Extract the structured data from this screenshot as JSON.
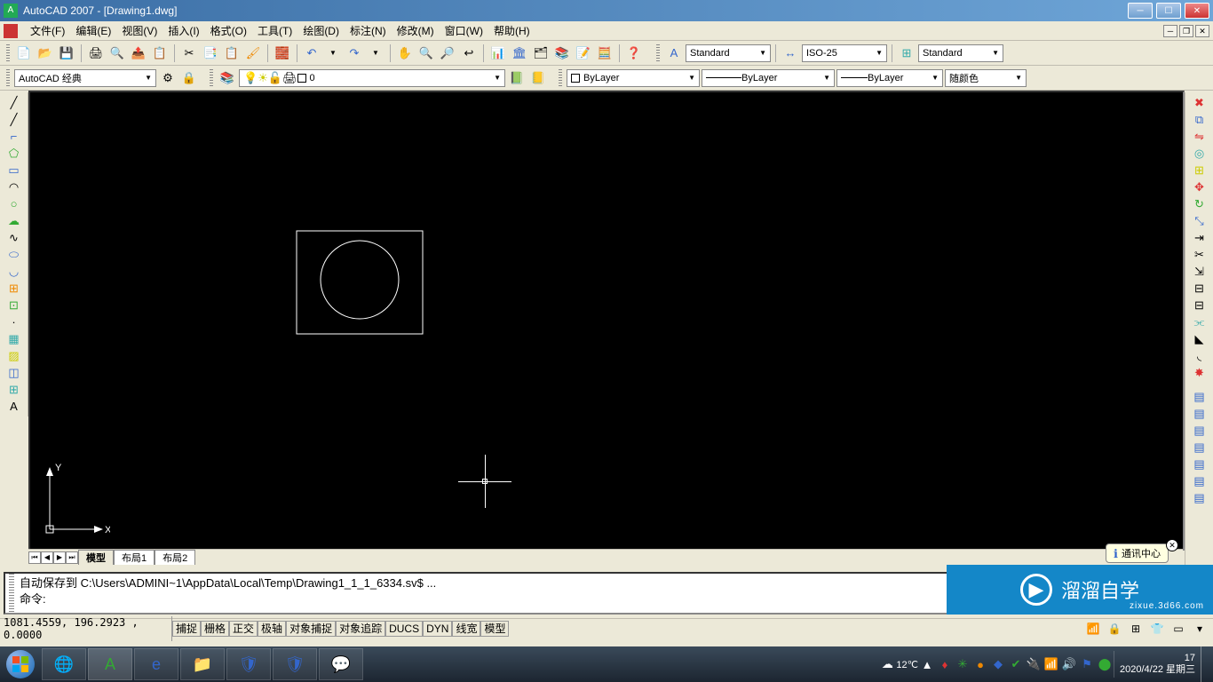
{
  "title": "AutoCAD 2007 - [Drawing1.dwg]",
  "menus": [
    "文件(F)",
    "编辑(E)",
    "视图(V)",
    "插入(I)",
    "格式(O)",
    "工具(T)",
    "绘图(D)",
    "标注(N)",
    "修改(M)",
    "窗口(W)",
    "帮助(H)"
  ],
  "workspace": "AutoCAD 经典",
  "layer": "0",
  "text_style": "Standard",
  "dim_style": "ISO-25",
  "table_style": "Standard",
  "linetype": "ByLayer",
  "lineweight": "ByLayer",
  "linetype2": "ByLayer",
  "color": "随颜色",
  "tabs": [
    "模型",
    "布局1",
    "布局2"
  ],
  "help_bubble": "通讯中心",
  "cmd_history": "自动保存到 C:\\Users\\ADMINI~1\\AppData\\Local\\Temp\\Drawing1_1_1_6334.sv$ ...",
  "cmd_prompt": "命令:",
  "coords": "1081.4559, 196.2923 , 0.0000",
  "status_toggles": [
    "捕捉",
    "栅格",
    "正交",
    "极轴",
    "对象捕捉",
    "对象追踪",
    "DUCS",
    "DYN",
    "线宽",
    "模型"
  ],
  "tray_temp": "12℃",
  "tray_time": "17",
  "tray_date": "2020/4/22",
  "tray_day": "星期三",
  "watermark_text": "溜溜自学",
  "watermark_sub": "zixue.3d66.com"
}
